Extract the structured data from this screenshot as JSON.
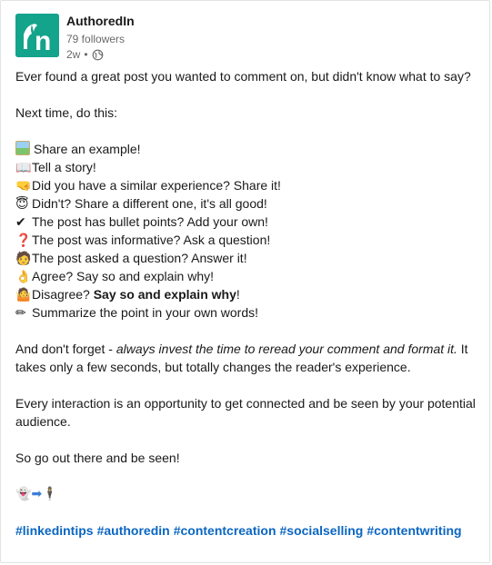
{
  "author": {
    "name": "AuthoredIn",
    "followers": "79 followers",
    "time": "2w",
    "separator": "•"
  },
  "post": {
    "intro": "Ever found a great post you wanted to comment on, but didn't know what to say?",
    "next_time": "Next time, do this:",
    "list": [
      {
        "icon": "picture-icon",
        "glyph": "🖼",
        "text": "Share an example!"
      },
      {
        "icon": "book-icon",
        "glyph": "📖",
        "text": "Tell a story!"
      },
      {
        "icon": "hand-icon",
        "glyph": "🤜",
        "text": "Did you have a similar experience? Share it!"
      },
      {
        "icon": "halo-face-icon",
        "glyph": "😇",
        "text": "Didn't? Share a different one, it's all good!"
      },
      {
        "icon": "check-icon",
        "glyph": "✔",
        "text": "The post has bullet points? Add your own!"
      },
      {
        "icon": "question-icon",
        "glyph": "❓",
        "text": "The post was informative? Ask a question!"
      },
      {
        "icon": "teacher-icon",
        "glyph": "🧑",
        "text": "The post asked a question? Answer it!"
      },
      {
        "icon": "ok-hand-icon",
        "glyph": "👌",
        "text": "Agree? Say so and explain why!"
      },
      {
        "icon": "person-shrug-icon",
        "glyph": "🤷",
        "text_plain": "Disagree? ",
        "text_bold": "Say so and explain why",
        "text_end": "!"
      },
      {
        "icon": "pencil-icon",
        "glyph": "✏",
        "text": "Summarize the point in your own words!"
      }
    ],
    "forget_prefix": "And don't forget - ",
    "forget_italic": "always invest the time to reread your comment and format it.",
    "forget_suffix": " It takes only a few seconds, but totally changes the reader's experience.",
    "interaction": "Every interaction is an opportunity to get connected and be seen by your potential audience.",
    "closing": "So go out there and be seen!",
    "emoji_row": [
      {
        "icon": "ghost-icon",
        "glyph": "👻"
      },
      {
        "icon": "right-arrow-icon",
        "glyph": "➡"
      },
      {
        "icon": "person-standing-icon",
        "glyph": "🕴"
      }
    ],
    "hashtags": [
      "#linkedintips",
      "#authoredin",
      "#contentcreation",
      "#socialselling",
      "#contentwriting"
    ]
  },
  "colors": {
    "brand": "#14a38b",
    "link": "#0a66c2"
  }
}
